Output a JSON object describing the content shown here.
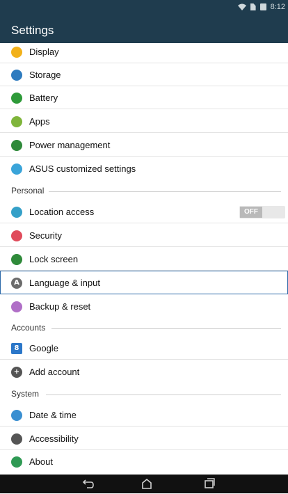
{
  "status": {
    "time": "8:12"
  },
  "app": {
    "title": "Settings"
  },
  "rows_top": [
    {
      "label": "Display",
      "color": "#f2b11a",
      "glyph": ""
    },
    {
      "label": "Storage",
      "color": "#2e7bbf",
      "glyph": ""
    },
    {
      "label": "Battery",
      "color": "#2e9a39",
      "glyph": ""
    },
    {
      "label": "Apps",
      "color": "#7fb53b",
      "glyph": ""
    },
    {
      "label": "Power management",
      "color": "#2f8a3a",
      "glyph": ""
    },
    {
      "label": "ASUS customized settings",
      "color": "#3aa4d9",
      "glyph": ""
    }
  ],
  "sections": {
    "personal": "Personal",
    "accounts": "Accounts",
    "system": "System"
  },
  "rows_personal": [
    {
      "label": "Location access",
      "color": "#35a0c8",
      "glyph": ""
    },
    {
      "label": "Security",
      "color": "#e04b5b",
      "glyph": ""
    },
    {
      "label": "Lock screen",
      "color": "#2f8a3a",
      "glyph": ""
    },
    {
      "label": "Language & input",
      "color": "#6b6b6b",
      "glyph": "A"
    },
    {
      "label": "Backup & reset",
      "color": "#b06fc7",
      "glyph": ""
    }
  ],
  "rows_accounts": [
    {
      "label": "Google",
      "color": "#2b77c9",
      "glyph": "8"
    },
    {
      "label": "Add account",
      "color": "#555555",
      "glyph": "+"
    }
  ],
  "rows_system": [
    {
      "label": "Date & time",
      "color": "#3a8fd1",
      "glyph": ""
    },
    {
      "label": "Accessibility",
      "color": "#555555",
      "glyph": ""
    },
    {
      "label": "About",
      "color": "#2f9a54",
      "glyph": ""
    }
  ],
  "toggle": {
    "location_access": "OFF"
  },
  "nav": {
    "back_icon": "back-icon",
    "home_icon": "home-icon",
    "recents_icon": "recents-icon"
  }
}
